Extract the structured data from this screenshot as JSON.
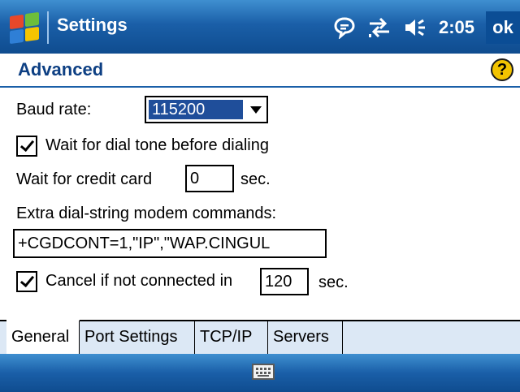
{
  "titlebar": {
    "title": "Settings",
    "clock": "2:05",
    "ok_label": "ok"
  },
  "header": {
    "title": "Advanced"
  },
  "form": {
    "baud_rate_label": "Baud rate:",
    "baud_rate_value": "115200",
    "wait_dial_tone_label": "Wait for dial tone before dialing",
    "wait_credit_card_label": "Wait for credit card",
    "wait_credit_card_value": "0",
    "sec_label_1": "sec.",
    "extra_commands_label": "Extra dial-string modem commands:",
    "extra_commands_value": "+CGDCONT=1,\"IP\",\"WAP.CINGUL",
    "cancel_label": "Cancel if not connected in",
    "cancel_value": "120",
    "sec_label_2": "sec."
  },
  "tabs": [
    "General",
    "Port Settings",
    "TCP/IP",
    "Servers"
  ],
  "colors": {
    "titlebar": "#1a5fa8",
    "header_text": "#0d3f83",
    "tabbar_bg": "#dce8f5"
  }
}
